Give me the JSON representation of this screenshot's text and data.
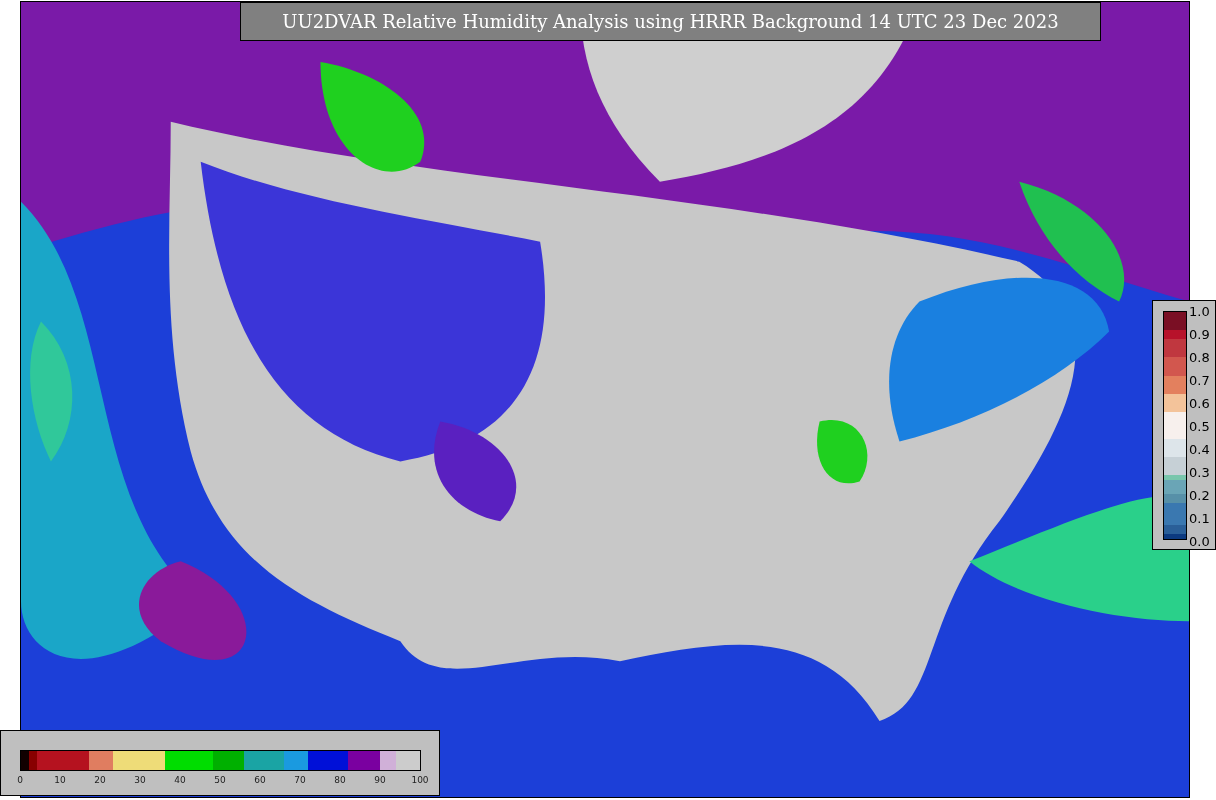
{
  "title": "UU2DVAR Relative Humidity Analysis using HRRR Background 14 UTC 23 Dec 2023",
  "station_scale": {
    "ticks": [
      "1.0",
      "0.9",
      "0.8",
      "0.7",
      "0.6",
      "0.5",
      "0.4",
      "0.3",
      "0.2",
      "0.1",
      "0.0"
    ]
  },
  "humidity_scale": {
    "ticks": [
      "0",
      "10",
      "20",
      "30",
      "40",
      "50",
      "60",
      "70",
      "80",
      "90",
      "100"
    ]
  }
}
